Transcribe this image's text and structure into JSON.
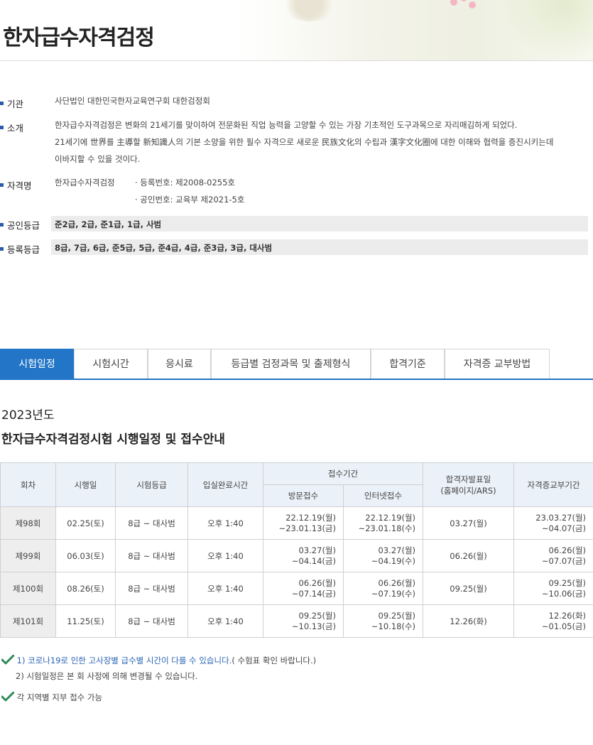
{
  "header": {
    "title": "한자급수자격검정"
  },
  "info": [
    {
      "label": "기관",
      "lines": [
        "사단법인 대한민국한자교육연구회 대한검정회"
      ]
    },
    {
      "label": "소개",
      "lines": [
        "한자급수자격검정은 변화의 21세기를 맞이하여 전문화된 직업 능력을 고양할 수 있는 가장 기초적인 도구과목으로 자리매김하게 되었다.",
        "21세기에 世界를 主導할 新知識人의 기본 소양을 위한 필수 자격으로 새로운 民族文化의 수립과 漢字文化圈에 대한 이해와 협력을 증진시키는데",
        "이바지할 수 있을 것이다."
      ]
    },
    {
      "label": "자격명",
      "name": "한자급수자격검정",
      "details": [
        "· 등록번호: 제2008-0255호",
        "· 공인번호: 교육부 제2021-5호"
      ]
    },
    {
      "label": "공인등급",
      "value": "준2급, 2급, 준1급, 1급, 사범"
    },
    {
      "label": "등록등급",
      "value": "8급, 7급, 6급, 준5급, 5급, 준4급, 4급, 준3급, 3급, 대사범"
    }
  ],
  "tabs": [
    {
      "label": "시험일정",
      "active": true
    },
    {
      "label": "시험시간",
      "active": false
    },
    {
      "label": "응시료",
      "active": false
    },
    {
      "label": "등급별 검정과목 및 출제형식",
      "active": false
    },
    {
      "label": "합격기준",
      "active": false
    },
    {
      "label": "자격증 교부방법",
      "active": false
    }
  ],
  "content": {
    "year": "2023년도",
    "subtitle": "한자급수자격검정시험 시행일정 및 접수안내"
  },
  "table": {
    "headers": {
      "round": "회차",
      "exam_date": "시행일",
      "grade": "시험등급",
      "entry_time": "입실완료시간",
      "reception": "접수기간",
      "visit": "방문접수",
      "internet": "인터넷접수",
      "result_line1": "합격자발표일",
      "result_line2": "(홈페이지/ARS)",
      "cert": "자격증교부기간"
    },
    "rows": [
      {
        "round": "제98회",
        "exam_date": "02.25(토)",
        "grade": "8급 ~ 대사범",
        "entry_time": "오후 1:40",
        "visit": [
          "22.12.19(월)",
          "~23.01.13(금)"
        ],
        "internet": [
          "22.12.19(월)",
          "~23.01.18(수)"
        ],
        "result": "03.27(월)",
        "cert": [
          "23.03.27(월)",
          "~04.07(금)"
        ]
      },
      {
        "round": "제99회",
        "exam_date": "06.03(토)",
        "grade": "8급 ~ 대사범",
        "entry_time": "오후 1:40",
        "visit": [
          "03.27(월)",
          "~04.14(금)"
        ],
        "internet": [
          "03.27(월)",
          "~04.19(수)"
        ],
        "result": "06.26(월)",
        "cert": [
          "06.26(월)",
          "~07.07(금)"
        ]
      },
      {
        "round": "제100회",
        "exam_date": "08.26(토)",
        "grade": "8급 ~ 대사범",
        "entry_time": "오후 1:40",
        "visit": [
          "06.26(월)",
          "~07.14(금)"
        ],
        "internet": [
          "06.26(월)",
          "~07.19(수)"
        ],
        "result": "09.25(월)",
        "cert": [
          "09.25(월)",
          "~10.06(금)"
        ]
      },
      {
        "round": "제101회",
        "exam_date": "11.25(토)",
        "grade": "8급 ~ 대사범",
        "entry_time": "오후 1:40",
        "visit": [
          "09.25(월)",
          "~10.13(금)"
        ],
        "internet": [
          "09.25(월)",
          "~10.18(수)"
        ],
        "result": "12.26(화)",
        "cert": [
          "12.26(화)",
          "~01.05(금)"
        ]
      }
    ]
  },
  "notes": {
    "note1_blue": "1) 코로나19로 인한 고사장별 급수별 시간이 다를 수 있습니다.",
    "note1_rest": "( 수험표 확인 바랍니다.)",
    "note2": "2) 시험일정은 본 회 사정에 의해 변경될 수 있습니다.",
    "note3": "각 지역별 지부 접수 가능"
  },
  "colors": {
    "accent": "#2275c7",
    "check": "#2e8b57",
    "label_square": "#2a5ca8"
  }
}
